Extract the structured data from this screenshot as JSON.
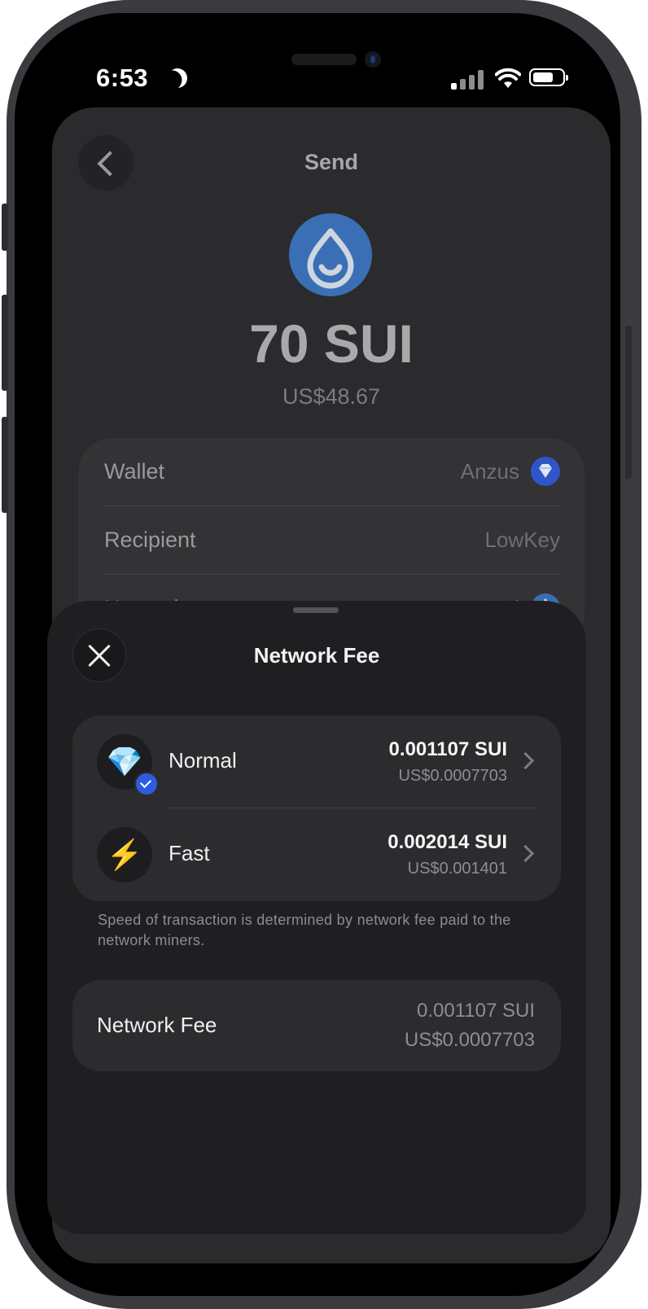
{
  "status_bar": {
    "time": "6:53"
  },
  "send": {
    "title": "Send",
    "amount": "70 SUI",
    "fiat": "US$48.67",
    "rows": [
      {
        "label": "Wallet",
        "value": "Anzus",
        "icon": "diamond-icon"
      },
      {
        "label": "Recipient",
        "value": "LowKey"
      },
      {
        "label": "Network",
        "value": "Sui",
        "icon": "sui-icon"
      }
    ]
  },
  "sheet": {
    "title": "Network Fee",
    "options": [
      {
        "name": "Normal",
        "amount": "0.001107 SUI",
        "fiat": "US$0.0007703",
        "selected": true,
        "icon": "gem-icon",
        "glyph": "💎"
      },
      {
        "name": "Fast",
        "amount": "0.002014 SUI",
        "fiat": "US$0.001401",
        "selected": false,
        "icon": "lightning-icon",
        "glyph": "⚡"
      }
    ],
    "hint": "Speed of transaction is determined by network fee paid to the network miners.",
    "summary": {
      "label": "Network Fee",
      "amount": "0.001107 SUI",
      "fiat": "US$0.0007703"
    }
  },
  "colors": {
    "accent": "#2d5ce0",
    "sui_blue": "#3a6fb5",
    "sheet_bg": "#1f1f21",
    "card_bg": "#2c2c2e"
  }
}
